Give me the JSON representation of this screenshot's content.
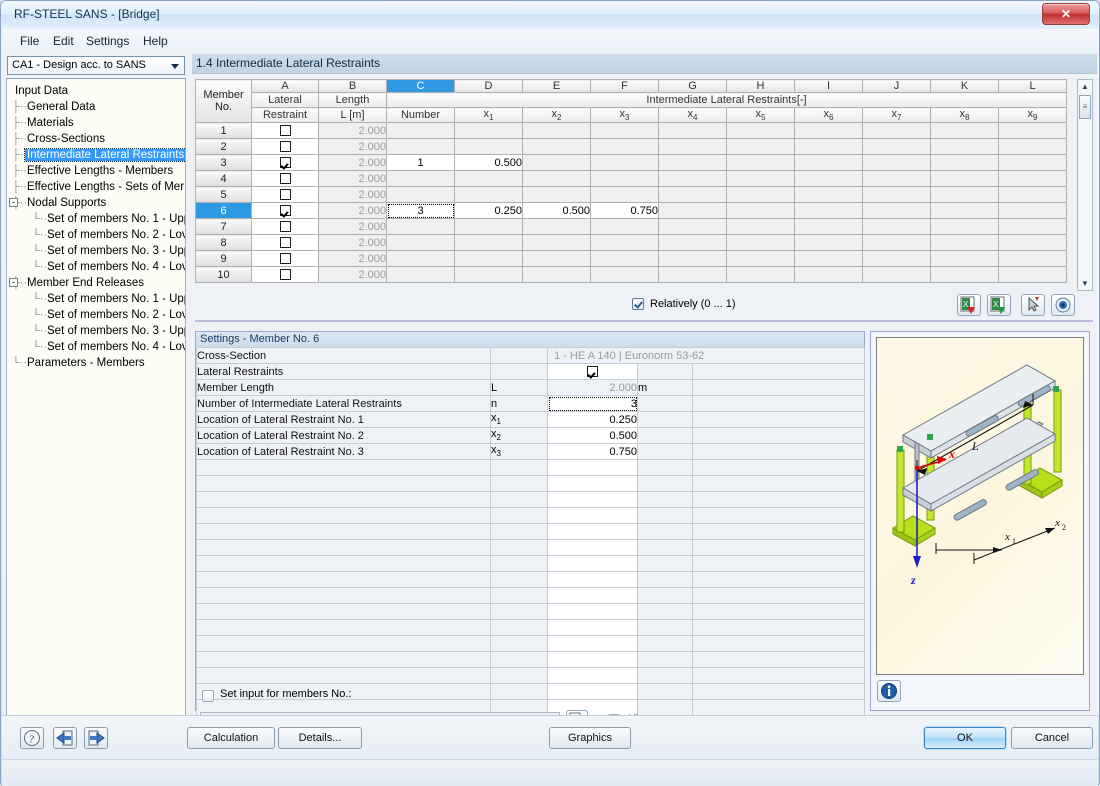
{
  "window": {
    "title": "RF-STEEL SANS - [Bridge]",
    "close_label": "✕"
  },
  "menu": [
    "File",
    "Edit",
    "Settings",
    "Help"
  ],
  "combo": {
    "selected": "CA1 - Design acc. to SANS"
  },
  "tree": {
    "root": "Input Data",
    "items": [
      {
        "label": "General Data",
        "level": 1,
        "selected": false
      },
      {
        "label": "Materials",
        "level": 1,
        "selected": false
      },
      {
        "label": "Cross-Sections",
        "level": 1,
        "selected": false
      },
      {
        "label": "Intermediate Lateral Restraints",
        "level": 1,
        "selected": true
      },
      {
        "label": "Effective Lengths - Members",
        "level": 1,
        "selected": false
      },
      {
        "label": "Effective Lengths - Sets of Mer",
        "level": 1,
        "selected": false
      },
      {
        "label": "Nodal Supports",
        "level": 1,
        "selected": false,
        "expander": "-"
      },
      {
        "label": "Set of members No. 1 - Upp",
        "level": 2,
        "selected": false
      },
      {
        "label": "Set of members No. 2 - Lov",
        "level": 2,
        "selected": false
      },
      {
        "label": "Set of members No. 3 - Upp",
        "level": 2,
        "selected": false
      },
      {
        "label": "Set of members No. 4 - Lov",
        "level": 2,
        "selected": false
      },
      {
        "label": "Member End Releases",
        "level": 1,
        "selected": false,
        "expander": "-"
      },
      {
        "label": "Set of members No. 1 - Upp",
        "level": 2,
        "selected": false
      },
      {
        "label": "Set of members No. 2 - Lov",
        "level": 2,
        "selected": false
      },
      {
        "label": "Set of members No. 3 - Upp",
        "level": 2,
        "selected": false
      },
      {
        "label": "Set of members No. 4 - Lov",
        "level": 2,
        "selected": false
      },
      {
        "label": "Parameters - Members",
        "level": 1,
        "selected": false
      }
    ]
  },
  "section": {
    "title": "1.4 Intermediate Lateral Restraints"
  },
  "grid": {
    "column_letters": [
      "A",
      "B",
      "C",
      "D",
      "E",
      "F",
      "G",
      "H",
      "I",
      "J",
      "K",
      "L"
    ],
    "active_column": "C",
    "corner_header": [
      "Member",
      "No."
    ],
    "sub_headers": [
      "Lateral\nRestraint",
      "Length\nL [m]",
      "Number",
      "x1",
      "x2",
      "x3",
      "x4",
      "x5",
      "x6",
      "x7",
      "x8",
      "x9"
    ],
    "header_a": [
      "Lateral",
      "Restraint"
    ],
    "header_b": [
      "Length",
      "L [m]"
    ],
    "header_c": "Number",
    "group_header": "Intermediate Lateral Restraints[-]",
    "x_headers": [
      "x1",
      "x2",
      "x3",
      "x4",
      "x5",
      "x6",
      "x7",
      "x8",
      "x9"
    ],
    "selected_row": 6,
    "rows": [
      {
        "no": "1",
        "restraint": false,
        "length": "2.000",
        "number": "",
        "x": [
          "",
          "",
          "",
          "",
          "",
          "",
          "",
          "",
          ""
        ]
      },
      {
        "no": "2",
        "restraint": false,
        "length": "2.000",
        "number": "",
        "x": [
          "",
          "",
          "",
          "",
          "",
          "",
          "",
          "",
          ""
        ]
      },
      {
        "no": "3",
        "restraint": true,
        "length": "2.000",
        "number": "1",
        "x": [
          "0.500",
          "",
          "",
          "",
          "",
          "",
          "",
          "",
          ""
        ]
      },
      {
        "no": "4",
        "restraint": false,
        "length": "2.000",
        "number": "",
        "x": [
          "",
          "",
          "",
          "",
          "",
          "",
          "",
          "",
          ""
        ]
      },
      {
        "no": "5",
        "restraint": false,
        "length": "2.000",
        "number": "",
        "x": [
          "",
          "",
          "",
          "",
          "",
          "",
          "",
          "",
          ""
        ]
      },
      {
        "no": "6",
        "restraint": true,
        "length": "2.000",
        "number": "3",
        "x": [
          "0.250",
          "0.500",
          "0.750",
          "",
          "",
          "",
          "",
          "",
          ""
        ]
      },
      {
        "no": "7",
        "restraint": false,
        "length": "2.000",
        "number": "",
        "x": [
          "",
          "",
          "",
          "",
          "",
          "",
          "",
          "",
          ""
        ]
      },
      {
        "no": "8",
        "restraint": false,
        "length": "2.000",
        "number": "",
        "x": [
          "",
          "",
          "",
          "",
          "",
          "",
          "",
          "",
          ""
        ]
      },
      {
        "no": "9",
        "restraint": false,
        "length": "2.000",
        "number": "",
        "x": [
          "",
          "",
          "",
          "",
          "",
          "",
          "",
          "",
          ""
        ]
      },
      {
        "no": "10",
        "restraint": false,
        "length": "2.000",
        "number": "",
        "x": [
          "",
          "",
          "",
          "",
          "",
          "",
          "",
          "",
          ""
        ]
      }
    ]
  },
  "relatively": {
    "label": "Relatively (0 ... 1)",
    "checked": true
  },
  "grid_tools": [
    {
      "name": "import-from-excel-icon"
    },
    {
      "name": "export-to-excel-icon"
    },
    {
      "name": "pick-member-icon"
    },
    {
      "name": "view-mode-icon"
    }
  ],
  "settings": {
    "title": "Settings - Member No. 6",
    "rows": [
      {
        "label": "Cross-Section",
        "symbol": "",
        "value": "1 - HE A 140 | Euronorm 53-62",
        "unit": "",
        "type": "crosssection"
      },
      {
        "label": "Lateral Restraints",
        "symbol": "",
        "value": "",
        "unit": "",
        "type": "checkbox",
        "checked": true
      },
      {
        "label": "Member Length",
        "symbol": "L",
        "value": "2.000",
        "unit": "m",
        "type": "readonly"
      },
      {
        "label": "Number of Intermediate Lateral Restraints",
        "symbol": "n",
        "value": "3",
        "unit": "",
        "type": "focus"
      },
      {
        "label": "Location of Lateral Restraint No. 1",
        "symbol": "x1",
        "value": "0.250",
        "unit": "",
        "type": "value"
      },
      {
        "label": "Location of Lateral Restraint No. 2",
        "symbol": "x2",
        "value": "0.500",
        "unit": "",
        "type": "value"
      },
      {
        "label": "Location of Lateral Restraint No. 3",
        "symbol": "x3",
        "value": "0.750",
        "unit": "",
        "type": "value"
      }
    ],
    "set_input_label": "Set input for members No.:",
    "set_input_checked": false,
    "members_value": "",
    "all_label": "All",
    "all_checked": true
  },
  "graphic": {
    "labels": {
      "length": "L",
      "x1": "x1",
      "x2": "x2",
      "axis_x": "x",
      "axis_z": "z"
    },
    "colors": {
      "support": "#b8e01a",
      "beam": "#d8dee4",
      "axis_x": "#e00000",
      "axis_z": "#2020c0"
    },
    "info_icon": "info-icon"
  },
  "bottom": {
    "help_icon": "help-icon",
    "prev_icon": "previous-icon",
    "next_icon": "next-icon",
    "calculation": "Calculation",
    "details": "Details...",
    "graphics": "Graphics",
    "ok": "OK",
    "cancel": "Cancel"
  }
}
